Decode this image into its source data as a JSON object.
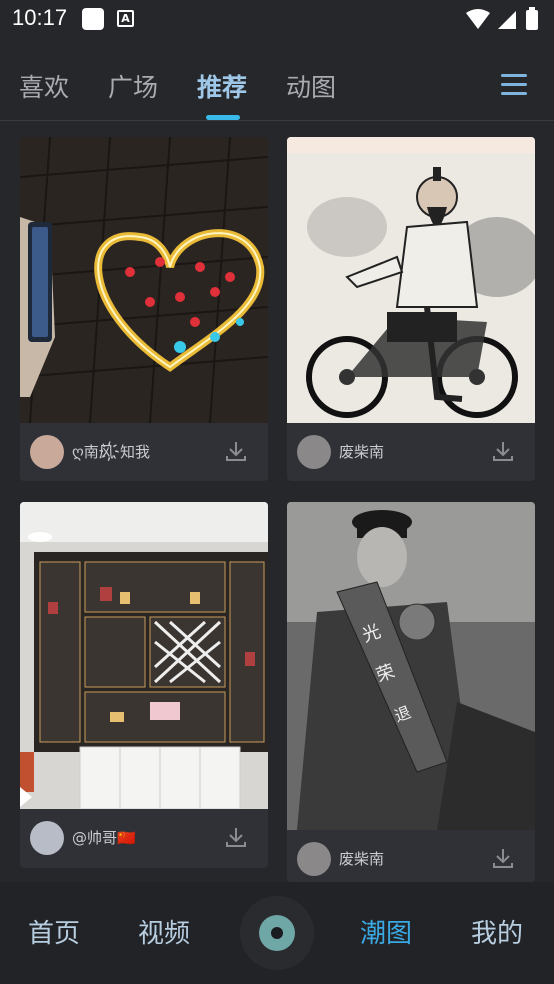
{
  "status_bar": {
    "time": "10:17",
    "notif_icon": "a-badge-icon"
  },
  "top_tabs": [
    {
      "label": "喜欢",
      "active": false
    },
    {
      "label": "广场",
      "active": false
    },
    {
      "label": "推荐",
      "active": true
    },
    {
      "label": "动图",
      "active": false
    }
  ],
  "feed": [
    {
      "author": "ღ南风҉知我",
      "image": "heart-candles-photo"
    },
    {
      "author": "废柴南",
      "image": "ink-warrior-motorcycle-drawing"
    },
    {
      "author": "@帅哥🇨🇳",
      "image": "display-cabinet-photo"
    },
    {
      "author": "废柴南",
      "image": "bw-man-sash-photo"
    }
  ],
  "bottom_nav": [
    {
      "label": "首页",
      "active": false
    },
    {
      "label": "视频",
      "active": false
    },
    {
      "label": "潮图",
      "active": true
    },
    {
      "label": "我的",
      "active": false
    }
  ],
  "colors": {
    "accent": "#38b9ea",
    "active_tab": "#9fc7e7",
    "nav_active": "#3aa8e2",
    "background": "#26272b"
  }
}
